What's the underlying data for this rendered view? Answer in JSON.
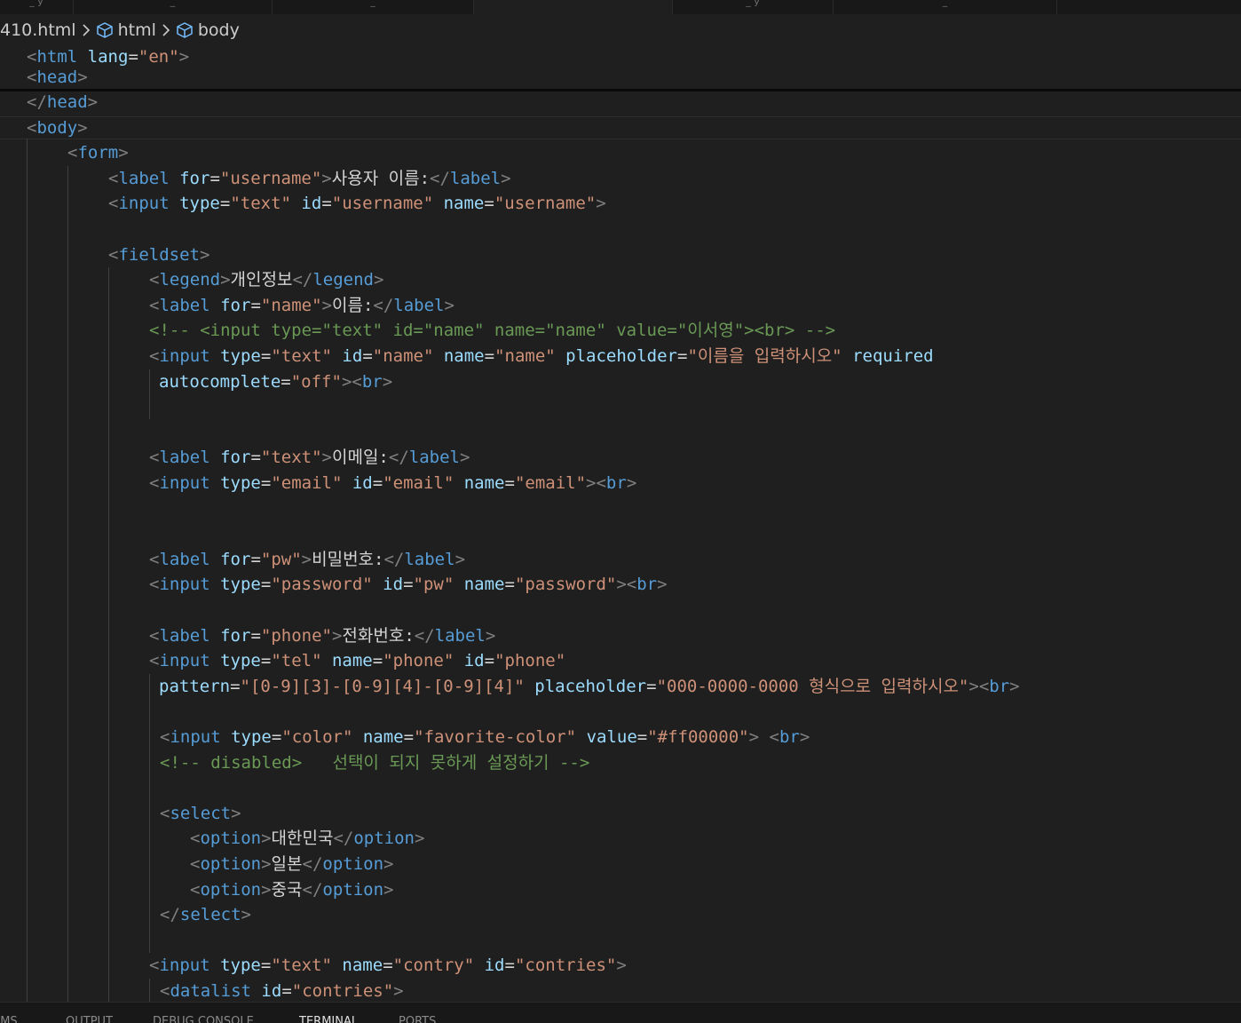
{
  "editor_tabs": [
    {
      "label": "_ y"
    },
    {
      "label": "_"
    },
    {
      "label": "_"
    },
    {
      "label": ""
    },
    {
      "label": "_ y"
    },
    {
      "label": "_"
    }
  ],
  "breadcrumb": {
    "file": "410.html",
    "items": [
      "html",
      "body"
    ]
  },
  "sticky_lines": [
    [
      [
        "t",
        "<"
      ],
      [
        "tn",
        "html"
      ],
      [
        "tx",
        " "
      ],
      [
        "an",
        "lang"
      ],
      [
        "tx",
        "="
      ],
      [
        "av",
        "\"en\""
      ],
      [
        "t",
        ">"
      ]
    ],
    [
      [
        "t",
        "<"
      ],
      [
        "tn",
        "head"
      ],
      [
        "t",
        ">"
      ]
    ]
  ],
  "code_lines": [
    [
      [
        "t",
        "</"
      ],
      [
        "tn",
        "head"
      ],
      [
        "t",
        ">"
      ]
    ],
    [
      [
        "t",
        "<"
      ],
      [
        "tn",
        "body"
      ],
      [
        "t",
        ">"
      ]
    ],
    [
      [
        "t",
        "<"
      ],
      [
        "tn",
        "form"
      ],
      [
        "t",
        ">"
      ]
    ],
    [
      [
        "t",
        "<"
      ],
      [
        "tn",
        "label"
      ],
      [
        "tx",
        " "
      ],
      [
        "an",
        "for"
      ],
      [
        "tx",
        "="
      ],
      [
        "av",
        "\"username\""
      ],
      [
        "t",
        ">"
      ],
      [
        "tx",
        "사용자 이름:"
      ],
      [
        "t",
        "</"
      ],
      [
        "tn",
        "label"
      ],
      [
        "t",
        ">"
      ]
    ],
    [
      [
        "t",
        "<"
      ],
      [
        "tn",
        "input"
      ],
      [
        "tx",
        " "
      ],
      [
        "an",
        "type"
      ],
      [
        "tx",
        "="
      ],
      [
        "av",
        "\"text\""
      ],
      [
        "tx",
        " "
      ],
      [
        "an",
        "id"
      ],
      [
        "tx",
        "="
      ],
      [
        "av",
        "\"username\""
      ],
      [
        "tx",
        " "
      ],
      [
        "an",
        "name"
      ],
      [
        "tx",
        "="
      ],
      [
        "av",
        "\"username\""
      ],
      [
        "t",
        ">"
      ]
    ],
    [],
    [
      [
        "t",
        "<"
      ],
      [
        "tn",
        "fieldset"
      ],
      [
        "t",
        ">"
      ]
    ],
    [
      [
        "t",
        "<"
      ],
      [
        "tn",
        "legend"
      ],
      [
        "t",
        ">"
      ],
      [
        "tx",
        "개인정보"
      ],
      [
        "t",
        "</"
      ],
      [
        "tn",
        "legend"
      ],
      [
        "t",
        ">"
      ]
    ],
    [
      [
        "t",
        "<"
      ],
      [
        "tn",
        "label"
      ],
      [
        "tx",
        " "
      ],
      [
        "an",
        "for"
      ],
      [
        "tx",
        "="
      ],
      [
        "av",
        "\"name\""
      ],
      [
        "t",
        ">"
      ],
      [
        "tx",
        "이름:"
      ],
      [
        "t",
        "</"
      ],
      [
        "tn",
        "label"
      ],
      [
        "t",
        ">"
      ]
    ],
    [
      [
        "cm",
        "<!-- <input type=\"text\" id=\"name\" name=\"name\" value=\"이서영\"><br> -->"
      ]
    ],
    [
      [
        "t",
        "<"
      ],
      [
        "tn",
        "input"
      ],
      [
        "tx",
        " "
      ],
      [
        "an",
        "type"
      ],
      [
        "tx",
        "="
      ],
      [
        "av",
        "\"text\""
      ],
      [
        "tx",
        " "
      ],
      [
        "an",
        "id"
      ],
      [
        "tx",
        "="
      ],
      [
        "av",
        "\"name\""
      ],
      [
        "tx",
        " "
      ],
      [
        "an",
        "name"
      ],
      [
        "tx",
        "="
      ],
      [
        "av",
        "\"name\""
      ],
      [
        "tx",
        " "
      ],
      [
        "an",
        "placeholder"
      ],
      [
        "tx",
        "="
      ],
      [
        "av",
        "\"이름을 입력하시오\""
      ],
      [
        "tx",
        " "
      ],
      [
        "an",
        "required"
      ]
    ],
    [
      [
        "an",
        "autocomplete"
      ],
      [
        "tx",
        "="
      ],
      [
        "av",
        "\"off\""
      ],
      [
        "t",
        "><"
      ],
      [
        "tn",
        "br"
      ],
      [
        "t",
        ">"
      ]
    ],
    [],
    [],
    [
      [
        "t",
        "<"
      ],
      [
        "tn",
        "label"
      ],
      [
        "tx",
        " "
      ],
      [
        "an",
        "for"
      ],
      [
        "tx",
        "="
      ],
      [
        "av",
        "\"text\""
      ],
      [
        "t",
        ">"
      ],
      [
        "tx",
        "이메일:"
      ],
      [
        "t",
        "</"
      ],
      [
        "tn",
        "label"
      ],
      [
        "t",
        ">"
      ]
    ],
    [
      [
        "t",
        "<"
      ],
      [
        "tn",
        "input"
      ],
      [
        "tx",
        " "
      ],
      [
        "an",
        "type"
      ],
      [
        "tx",
        "="
      ],
      [
        "av",
        "\"email\""
      ],
      [
        "tx",
        " "
      ],
      [
        "an",
        "id"
      ],
      [
        "tx",
        "="
      ],
      [
        "av",
        "\"email\""
      ],
      [
        "tx",
        " "
      ],
      [
        "an",
        "name"
      ],
      [
        "tx",
        "="
      ],
      [
        "av",
        "\"email\""
      ],
      [
        "t",
        "><"
      ],
      [
        "tn",
        "br"
      ],
      [
        "t",
        ">"
      ]
    ],
    [],
    [],
    [
      [
        "t",
        "<"
      ],
      [
        "tn",
        "label"
      ],
      [
        "tx",
        " "
      ],
      [
        "an",
        "for"
      ],
      [
        "tx",
        "="
      ],
      [
        "av",
        "\"pw\""
      ],
      [
        "t",
        ">"
      ],
      [
        "tx",
        "비밀번호:"
      ],
      [
        "t",
        "</"
      ],
      [
        "tn",
        "label"
      ],
      [
        "t",
        ">"
      ]
    ],
    [
      [
        "t",
        "<"
      ],
      [
        "tn",
        "input"
      ],
      [
        "tx",
        " "
      ],
      [
        "an",
        "type"
      ],
      [
        "tx",
        "="
      ],
      [
        "av",
        "\"password\""
      ],
      [
        "tx",
        " "
      ],
      [
        "an",
        "id"
      ],
      [
        "tx",
        "="
      ],
      [
        "av",
        "\"pw\""
      ],
      [
        "tx",
        " "
      ],
      [
        "an",
        "name"
      ],
      [
        "tx",
        "="
      ],
      [
        "av",
        "\"password\""
      ],
      [
        "t",
        "><"
      ],
      [
        "tn",
        "br"
      ],
      [
        "t",
        ">"
      ]
    ],
    [],
    [
      [
        "t",
        "<"
      ],
      [
        "tn",
        "label"
      ],
      [
        "tx",
        " "
      ],
      [
        "an",
        "for"
      ],
      [
        "tx",
        "="
      ],
      [
        "av",
        "\"phone\""
      ],
      [
        "t",
        ">"
      ],
      [
        "tx",
        "전화번호:"
      ],
      [
        "t",
        "</"
      ],
      [
        "tn",
        "label"
      ],
      [
        "t",
        ">"
      ]
    ],
    [
      [
        "t",
        "<"
      ],
      [
        "tn",
        "input"
      ],
      [
        "tx",
        " "
      ],
      [
        "an",
        "type"
      ],
      [
        "tx",
        "="
      ],
      [
        "av",
        "\"tel\""
      ],
      [
        "tx",
        " "
      ],
      [
        "an",
        "name"
      ],
      [
        "tx",
        "="
      ],
      [
        "av",
        "\"phone\""
      ],
      [
        "tx",
        " "
      ],
      [
        "an",
        "id"
      ],
      [
        "tx",
        "="
      ],
      [
        "av",
        "\"phone\""
      ]
    ],
    [
      [
        "an",
        "pattern"
      ],
      [
        "tx",
        "="
      ],
      [
        "av",
        "\"[0-9][3]-[0-9][4]-[0-9][4]\""
      ],
      [
        "tx",
        " "
      ],
      [
        "an",
        "placeholder"
      ],
      [
        "tx",
        "="
      ],
      [
        "av",
        "\"000-0000-0000 형식으로 입력하시오\""
      ],
      [
        "t",
        "><"
      ],
      [
        "tn",
        "br"
      ],
      [
        "t",
        ">"
      ]
    ],
    [],
    [
      [
        "t",
        "<"
      ],
      [
        "tn",
        "input"
      ],
      [
        "tx",
        " "
      ],
      [
        "an",
        "type"
      ],
      [
        "tx",
        "="
      ],
      [
        "av",
        "\"color\""
      ],
      [
        "tx",
        " "
      ],
      [
        "an",
        "name"
      ],
      [
        "tx",
        "="
      ],
      [
        "av",
        "\"favorite-color\""
      ],
      [
        "tx",
        " "
      ],
      [
        "an",
        "value"
      ],
      [
        "tx",
        "="
      ],
      [
        "av",
        "\"#ff00000\""
      ],
      [
        "t",
        ">"
      ],
      [
        "tx",
        " "
      ],
      [
        "t",
        "<"
      ],
      [
        "tn",
        "br"
      ],
      [
        "t",
        ">"
      ]
    ],
    [
      [
        "cm",
        "<!-- disabled>   선택이 되지 못하게 설정하기 -->"
      ]
    ],
    [],
    [
      [
        "t",
        "<"
      ],
      [
        "tn",
        "select"
      ],
      [
        "t",
        ">"
      ]
    ],
    [
      [
        "t",
        "<"
      ],
      [
        "tn",
        "option"
      ],
      [
        "t",
        ">"
      ],
      [
        "tx",
        "대한민국"
      ],
      [
        "t",
        "</"
      ],
      [
        "tn",
        "option"
      ],
      [
        "t",
        ">"
      ]
    ],
    [
      [
        "t",
        "<"
      ],
      [
        "tn",
        "option"
      ],
      [
        "t",
        ">"
      ],
      [
        "tx",
        "일본"
      ],
      [
        "t",
        "</"
      ],
      [
        "tn",
        "option"
      ],
      [
        "t",
        ">"
      ]
    ],
    [
      [
        "t",
        "<"
      ],
      [
        "tn",
        "option"
      ],
      [
        "t",
        ">"
      ],
      [
        "tx",
        "중국"
      ],
      [
        "t",
        "</"
      ],
      [
        "tn",
        "option"
      ],
      [
        "t",
        ">"
      ]
    ],
    [
      [
        "t",
        "</"
      ],
      [
        "tn",
        "select"
      ],
      [
        "t",
        ">"
      ]
    ],
    [],
    [
      [
        "t",
        "<"
      ],
      [
        "tn",
        "input"
      ],
      [
        "tx",
        " "
      ],
      [
        "an",
        "type"
      ],
      [
        "tx",
        "="
      ],
      [
        "av",
        "\"text\""
      ],
      [
        "tx",
        " "
      ],
      [
        "an",
        "name"
      ],
      [
        "tx",
        "="
      ],
      [
        "av",
        "\"contry\""
      ],
      [
        "tx",
        " "
      ],
      [
        "an",
        "id"
      ],
      [
        "tx",
        "="
      ],
      [
        "av",
        "\"contries\""
      ],
      [
        "t",
        ">"
      ]
    ],
    [
      [
        "t",
        "<"
      ],
      [
        "tn",
        "datalist"
      ],
      [
        "tx",
        " "
      ],
      [
        "an",
        "id"
      ],
      [
        "tx",
        "="
      ],
      [
        "av",
        "\"contries\""
      ],
      [
        "t",
        ">"
      ]
    ]
  ],
  "panel_tabs": [
    "EMS",
    "OUTPUT",
    "DEBUG CONSOLE",
    "TERMINAL",
    "PORTS"
  ],
  "active_panel_tab": "TERMINAL",
  "colors": {
    "editor_background": "#1f1f1f",
    "tag_bracket": "#808080",
    "tag_name": "#569cd6",
    "attribute_name": "#9cdcfe",
    "attribute_value": "#ce9178",
    "plain_text": "#d4d4d4",
    "comment": "#6a9955"
  },
  "icons": {
    "breadcrumb_separator": "chevron-right-icon",
    "breadcrumb_element": "html-element-cube-icon"
  }
}
